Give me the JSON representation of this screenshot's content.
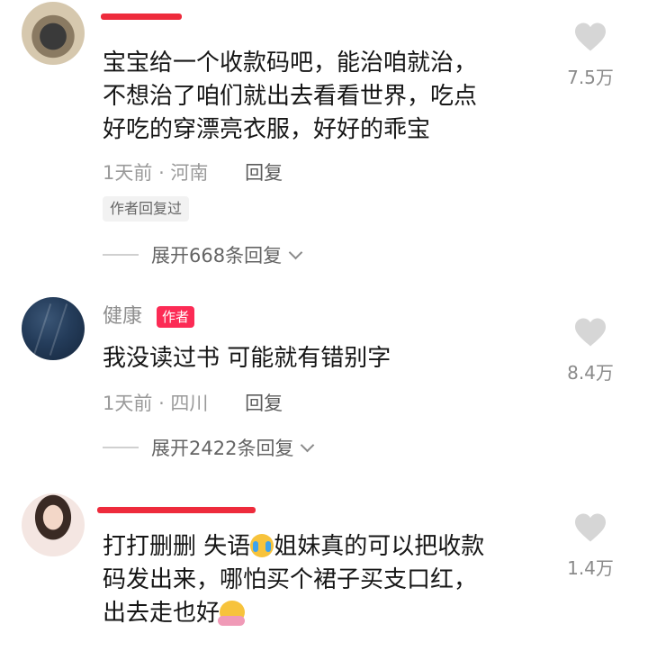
{
  "comments": [
    {
      "avatar": "avatar-pet-photo",
      "name": "",
      "text_lines": [
        "宝宝给一个收款码吧，能治咱就治，",
        "不想治了咱们就出去看看世界，吃点",
        "好吃的穿漂亮衣服，好好的乖宝"
      ],
      "time": "1天前",
      "location": "河南",
      "reply_label": "回复",
      "author_replied": "作者回复过",
      "expand_label": "展开668条回复",
      "likes": "7.5万"
    },
    {
      "avatar": "avatar-dark-blue",
      "name": "健康",
      "badge": "作者",
      "text_lines": [
        "我没读过书 可能就有错别字"
      ],
      "time": "1天前",
      "location": "四川",
      "reply_label": "回复",
      "expand_label": "展开2422条回复",
      "likes": "8.4万"
    },
    {
      "avatar": "avatar-woman-photo",
      "name": "",
      "text_lines": [
        "打打删删 失语",
        "姐妹真的可以把收款",
        "码发出来，哪怕买个裙子买支口红，",
        "出去走也好"
      ],
      "emojis": [
        "crying-emoji",
        "hugging-emoji"
      ],
      "likes": "1.4万"
    }
  ],
  "colors": {
    "redaction": "#ee2b3c",
    "author_badge": "#fc2b55",
    "like_heart": "#d6d6d6"
  }
}
